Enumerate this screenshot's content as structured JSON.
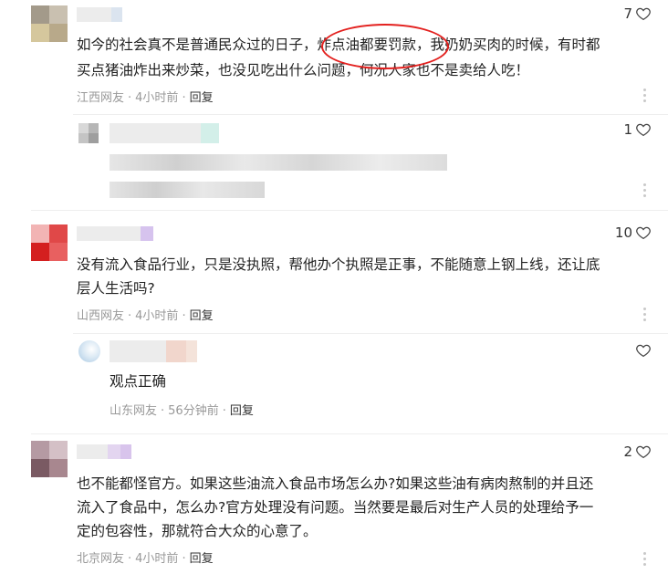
{
  "comments": [
    {
      "likes": "7",
      "text_lines": [
        "如今的社会真不是普通民众过的日子，炸点油都要罚款，我奶奶买肉的时候，有时都",
        "买点猪油炸出来炒菜，也没见吃出什么问题，何况人家也不是卖给人吃！"
      ],
      "location": "江西网友",
      "time": "4小时前",
      "reply": "回复"
    },
    {
      "likes": "1"
    },
    {
      "likes": "10",
      "text_lines": [
        "没有流入食品行业，只是没执照，帮他办个执照是正事，不能随意上钢上线，还让底",
        "层人生活吗?"
      ],
      "location": "山西网友",
      "time": "4小时前",
      "reply": "回复"
    },
    {
      "likes": "",
      "text_lines": [
        "观点正确"
      ],
      "location": "山东网友",
      "time": "56分钟前",
      "reply": "回复"
    },
    {
      "likes": "2",
      "text_lines": [
        "也不能都怪官方。如果这些油流入食品市场怎么办?如果这些油有病肉熬制的并且还",
        "流入了食品中，怎么办?官方处理没有问题。当然要是最后对生产人员的处理给予一",
        "定的包容性，那就符合大众的心意了。"
      ],
      "location": "北京网友",
      "time": "4小时前",
      "reply": "回复"
    }
  ],
  "colors": {
    "highlight_circle": "#e3211f",
    "meta_text": "#999999"
  },
  "icons": {
    "like": "heart-outline-icon",
    "more": "more-vertical-icon"
  }
}
